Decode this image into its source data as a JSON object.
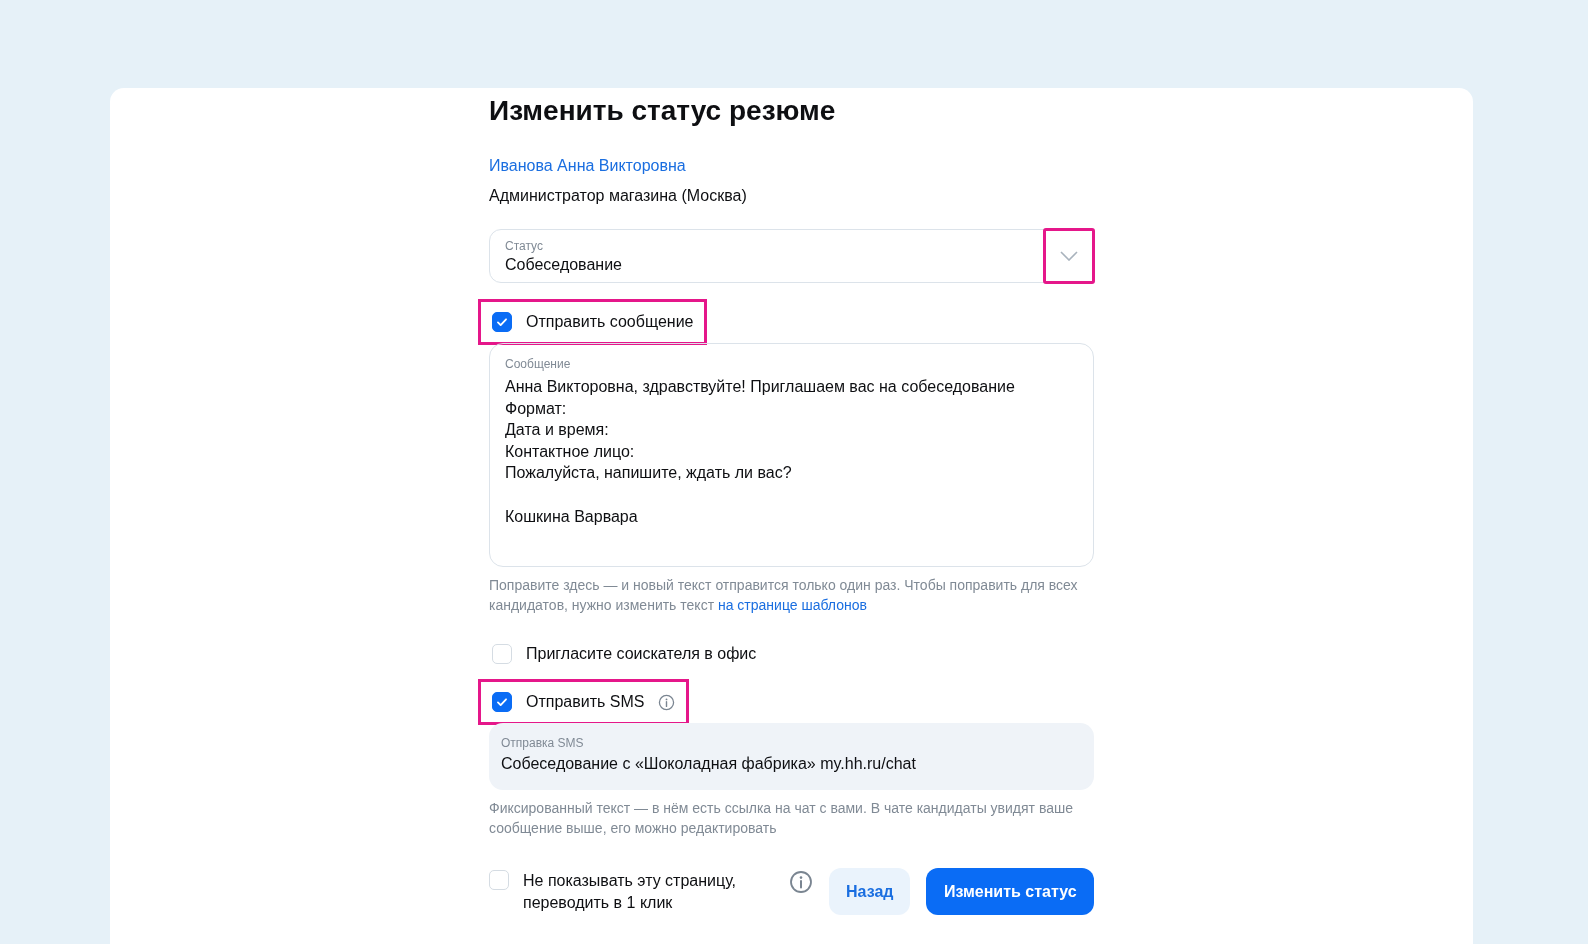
{
  "title": "Изменить статус резюме",
  "candidate": {
    "name": "Иванова Анна Викторовна",
    "position": "Администратор магазина (Москва)"
  },
  "status_select": {
    "label": "Статус",
    "value": "Собеседование",
    "chevron_highlighted": true
  },
  "send_message": {
    "label": "Отправить сообщение",
    "checked": true,
    "highlighted": true
  },
  "message": {
    "label": "Сообщение",
    "value": "Анна Викторовна, здравствуйте! Приглашаем вас на собеседование\nФормат:\nДата и время:\nКонтактное лицо:\nПожалуйста, напишите, ждать ли вас?\n\nКошкина Варвара"
  },
  "message_hint": {
    "text": "Поправите здесь — и новый текст отправится только один раз. Чтобы поправить для всех кандидатов, нужно изменить текст",
    "link": "на странице шаблонов"
  },
  "invite_office": {
    "label": "Пригласите соискателя в офис",
    "checked": false,
    "highlighted": false
  },
  "send_sms": {
    "label": "Отправить SMS",
    "checked": true,
    "highlighted": true
  },
  "sms": {
    "label": "Отправка SMS",
    "value": "Собеседование с «Шоколадная фабрика» my.hh.ru/chat"
  },
  "sms_hint": "Фиксированный текст — в нём есть ссылка на чат с вами. В чате кандидаты увидят ваше сообщение выше, его можно редактировать",
  "skip_page": {
    "label": "Не показывать эту страницу, переводить в 1 клик",
    "checked": false
  },
  "buttons": [
    {
      "label": "Назад",
      "kind": "secondary"
    },
    {
      "label": "Изменить статус",
      "kind": "primary"
    }
  ]
}
